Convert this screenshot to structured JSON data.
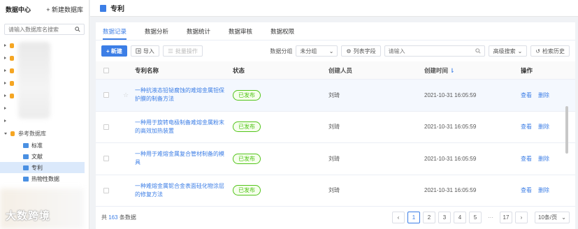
{
  "sidebar": {
    "title": "数据中心",
    "new_db": "+ 新建数据库",
    "search_placeholder": "请输入数据库名搜索",
    "tree_root": "参考数据库",
    "children": [
      {
        "label": "标准",
        "active": false
      },
      {
        "label": "文献",
        "active": false
      },
      {
        "label": "专利",
        "active": true
      },
      {
        "label": "热物性数据",
        "active": false
      }
    ],
    "watermark": "大数跨境"
  },
  "header": {
    "title": "专利"
  },
  "tabs": [
    {
      "label": "数据记录",
      "active": true
    },
    {
      "label": "数据分析",
      "active": false
    },
    {
      "label": "数据统计",
      "active": false
    },
    {
      "label": "数据审核",
      "active": false
    },
    {
      "label": "数据权限",
      "active": false
    }
  ],
  "toolbar": {
    "new_label": "+ 新建",
    "import_label": "导入",
    "batch_label": "批量操作",
    "group_label": "数据分组",
    "group_value": "未分组",
    "fields_label": "列表字段",
    "search_placeholder": "请输入",
    "advanced_label": "高级搜索",
    "history_label": "检索历史"
  },
  "table": {
    "columns": [
      "专利名称",
      "状态",
      "创建人员",
      "创建时间",
      "操作"
    ],
    "rows": [
      {
        "name": "一种抗液态铅铋腐蚀的难熔金属钽保护膜的制备方法",
        "status": "已发布",
        "creator": "刘琦",
        "time": "2021-10-31 16:05:59",
        "view": "查看",
        "delete": "删除"
      },
      {
        "name": "一种用于旋转电极制备难熔金属粉末的高效加热装置",
        "status": "已发布",
        "creator": "刘琦",
        "time": "2021-10-31 16:05:59",
        "view": "查看",
        "delete": "删除"
      },
      {
        "name": "一种用于难熔金属复合管材制备的模具",
        "status": "已发布",
        "creator": "刘琦",
        "time": "2021-10-31 16:05:59",
        "view": "查看",
        "delete": "删除"
      },
      {
        "name": "一种难熔金属铌合金表面硅化物涂层的修复方法",
        "status": "已发布",
        "creator": "刘琦",
        "time": "2021-10-31 16:05:59",
        "view": "查看",
        "delete": "删除"
      }
    ]
  },
  "footer": {
    "total_prefix": "共",
    "total_count": "163",
    "total_suffix": "条数据",
    "pages": [
      "1",
      "2",
      "3",
      "4",
      "5",
      "···",
      "17"
    ],
    "active_page": "1",
    "page_size": "10条/页"
  }
}
